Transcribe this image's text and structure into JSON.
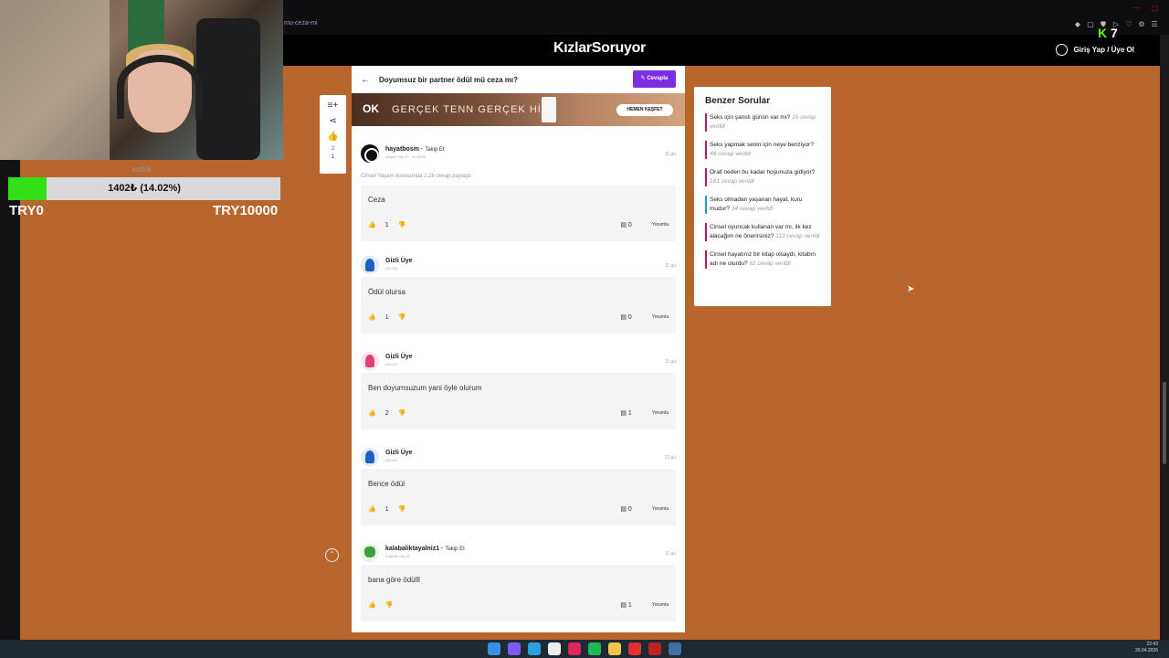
{
  "browser": {
    "url_fragment": "mu-ceza-mi"
  },
  "site": {
    "logo": "KızlarSoruyor",
    "login_label": "Giriş Yap / Üye Ol"
  },
  "stream": {
    "donation_label": "koltuk",
    "donation_text": "1402₺ (14.02%)",
    "donation_progress": 0.1402,
    "donation_min": "TRY0",
    "donation_max": "TRY10000",
    "kick_label": "K",
    "kick_count": "7",
    "accent_color": "#33e016"
  },
  "question": {
    "title": "Doyumsuz bir partner ödül mü ceza mı?",
    "answer_button": "Cevapla",
    "rail_count_red": "2",
    "rail_count": "1"
  },
  "ad": {
    "logo": "OK",
    "slogan": "GERÇEK TENN GERÇEK HİS",
    "cta": "HEMEN KEŞFET"
  },
  "answers": [
    {
      "user": "hayatbosm",
      "follow": "Takip Et",
      "meta": "Master Yaş 20 , xx 180%",
      "time": "11 gü",
      "topic": "Cinsel Yaşam konusunda 1.2b cevap paylaştı",
      "text": "Ceza",
      "likes": "1",
      "replies": "0",
      "reply_label": "Yorumla"
    },
    {
      "user": "Gizli Üye",
      "follow": "",
      "meta": "(20-29)",
      "time": "11 gü",
      "text": "Ödül olursa",
      "likes": "1",
      "replies": "0",
      "reply_label": "Yorumla"
    },
    {
      "user": "Gizli Üye",
      "follow": "",
      "meta": "(18-24)",
      "time": "11 gü",
      "text": "Ben doyumsuzum yani öyle olurum",
      "likes": "2",
      "replies": "1",
      "reply_label": "Yorumla"
    },
    {
      "user": "Gizli Üye",
      "follow": "",
      "meta": "(36-45)",
      "time": "13 gü",
      "text": "Bence ödül",
      "likes": "1",
      "replies": "0",
      "reply_label": "Yorumla"
    },
    {
      "user": "kalabaliktayalniz1",
      "follow": "Takip Et",
      "meta": "Kıdemli Yaş 43",
      "time": "11 gü",
      "text": "bana göre ödülll",
      "likes": "",
      "replies": "1",
      "reply_label": "Yorumla"
    }
  ],
  "similar": {
    "heading": "Benzer Sorular",
    "items": [
      {
        "q": "Seks için şanslı günün var mı?",
        "count": "15 cevap verildi",
        "color": "#c8194f"
      },
      {
        "q": "Seks yapmak senin için neye benziyor?",
        "count": "48 cevap verildi",
        "color": "#c8194f"
      },
      {
        "q": "Orall neden bu kadar hoşunuza gidiyor?",
        "count": "181 cevap verildi",
        "color": "#c8194f"
      },
      {
        "q": "Seks olmadan yaşanan hayat, kuru mudur?",
        "count": "34 cevap verildi",
        "color": "#1ea0d6"
      },
      {
        "q": "Cinsel oyuncak kullanan var mı, ilk kez alacağım ne önerirsiniz?",
        "count": "113 cevap verildi",
        "color": "#c8194f"
      },
      {
        "q": "Cinsel hayatınız bir kitap olsaydı, kitabın adı ne olurdu?",
        "count": "61 cevap verildi",
        "color": "#c8194f"
      }
    ]
  },
  "taskbar": {
    "clock": "22:43",
    "date": "26.04.2026"
  }
}
